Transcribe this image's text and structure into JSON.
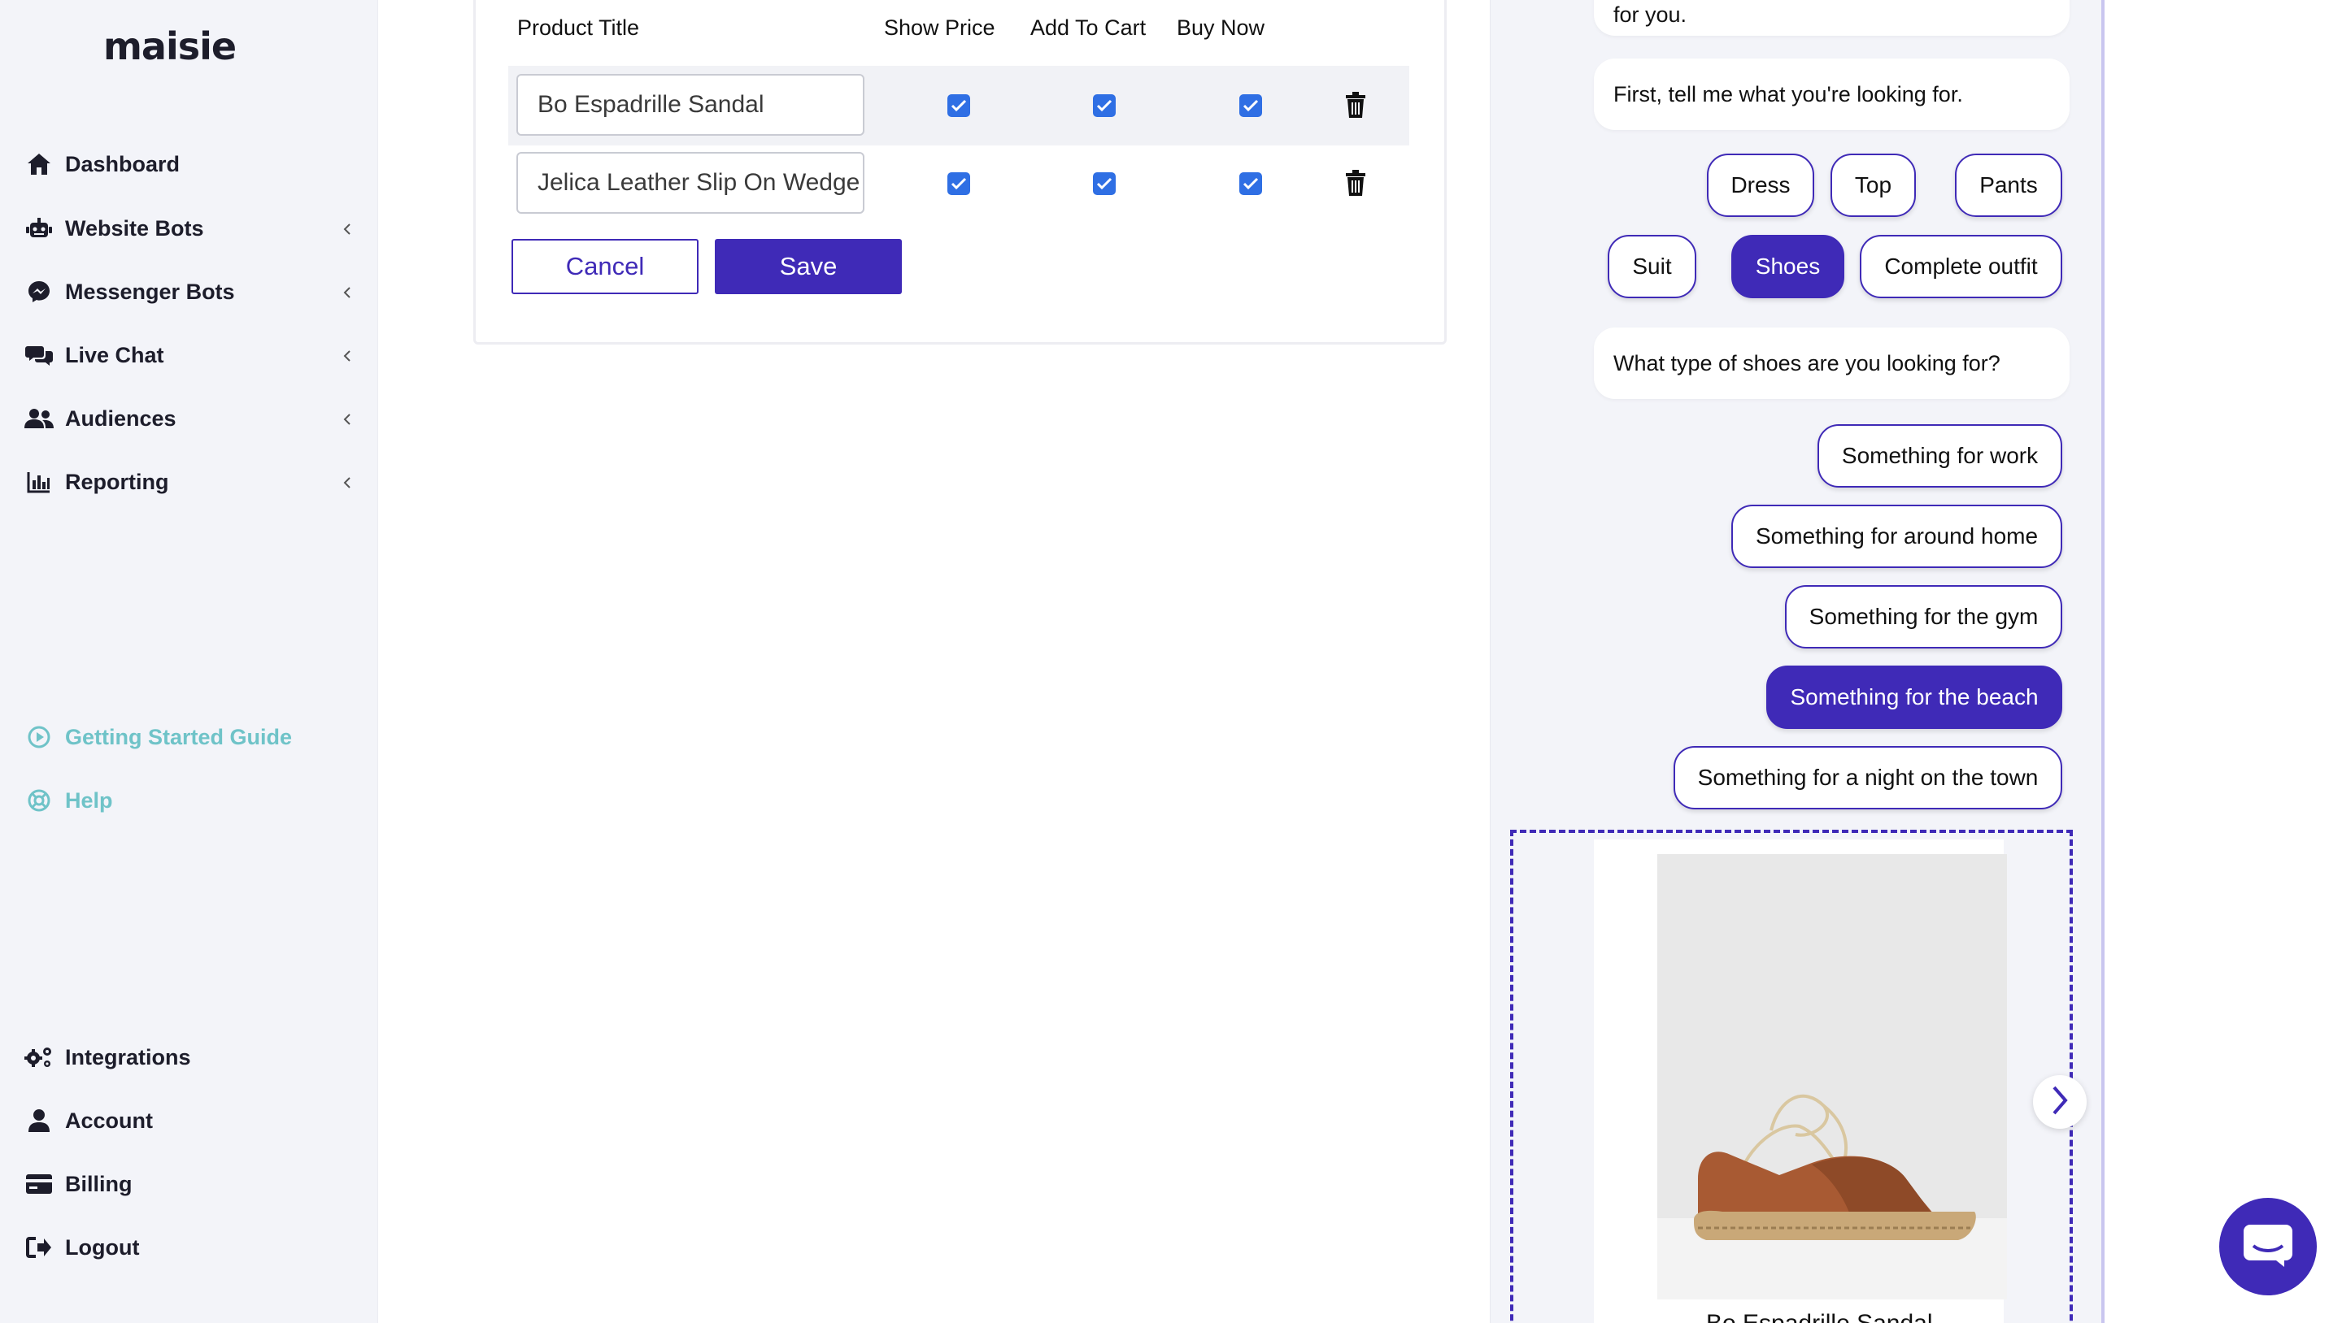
{
  "app": {
    "logo": "maisie"
  },
  "sidebar": {
    "top_items": [
      {
        "label": "Dashboard",
        "icon": "home-icon",
        "has_chevron": false
      },
      {
        "label": "Website Bots",
        "icon": "robot-icon",
        "has_chevron": true
      },
      {
        "label": "Messenger Bots",
        "icon": "messenger-icon",
        "has_chevron": true
      },
      {
        "label": "Live Chat",
        "icon": "chat-bubbles-icon",
        "has_chevron": true
      },
      {
        "label": "Audiences",
        "icon": "users-icon",
        "has_chevron": true
      },
      {
        "label": "Reporting",
        "icon": "bar-chart-icon",
        "has_chevron": true
      }
    ],
    "help_items": [
      {
        "label": "Getting Started Guide",
        "icon": "play-circle-icon"
      },
      {
        "label": "Help",
        "icon": "lifebuoy-icon"
      }
    ],
    "bottom_items": [
      {
        "label": "Integrations",
        "icon": "cogs-icon"
      },
      {
        "label": "Account",
        "icon": "user-icon"
      },
      {
        "label": "Billing",
        "icon": "credit-card-icon"
      },
      {
        "label": "Logout",
        "icon": "sign-out-icon"
      }
    ]
  },
  "editor": {
    "columns": {
      "title": "Product Title",
      "show_price": "Show Price",
      "add_to_cart": "Add To Cart",
      "buy_now": "Buy Now"
    },
    "rows": [
      {
        "title": "Bo Espadrille Sandal",
        "show_price": true,
        "add_to_cart": true,
        "buy_now": true
      },
      {
        "title": "Jelica Leather Slip On Wedge",
        "show_price": true,
        "add_to_cart": true,
        "buy_now": true
      }
    ],
    "cancel_label": "Cancel",
    "save_label": "Save"
  },
  "chat": {
    "partial_message": "for you.",
    "message_1": "First, tell me what you're looking for.",
    "category_options": [
      {
        "label": "Dress",
        "selected": false
      },
      {
        "label": "Top",
        "selected": false
      },
      {
        "label": "Pants",
        "selected": false
      },
      {
        "label": "Suit",
        "selected": false
      },
      {
        "label": "Shoes",
        "selected": true
      },
      {
        "label": "Complete outfit",
        "selected": false
      }
    ],
    "message_2": "What type of shoes are you looking for?",
    "shoe_options": [
      {
        "label": "Something for work",
        "selected": false
      },
      {
        "label": "Something for around home",
        "selected": false
      },
      {
        "label": "Something for the gym",
        "selected": false
      },
      {
        "label": "Something for the beach",
        "selected": true
      },
      {
        "label": "Something for a night on the town",
        "selected": false
      }
    ],
    "product_card": {
      "title": "Bo Espadrille Sandal"
    }
  },
  "colors": {
    "accent": "#3f2ab7",
    "checkbox": "#2f6fe4",
    "teal": "#6fc3c8",
    "sidebar_bg": "#f3f4f9"
  }
}
